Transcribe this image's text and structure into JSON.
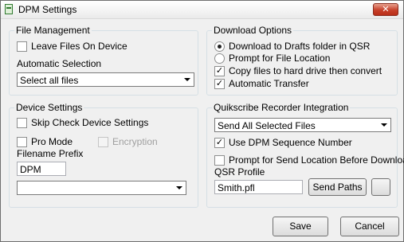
{
  "window": {
    "title": "DPM Settings",
    "close_label": "✕"
  },
  "file_management": {
    "title": "File Management",
    "leave_files_label": "Leave Files On Device",
    "leave_files_checked": false,
    "auto_selection_label": "Automatic Selection",
    "auto_selection_value": "Select all files"
  },
  "device_settings": {
    "title": "Device Settings",
    "skip_check_label": "Skip Check Device Settings",
    "skip_check_checked": false,
    "pro_mode_label": "Pro Mode",
    "pro_mode_checked": false,
    "encryption_label": "Encryption",
    "encryption_checked": false,
    "filename_prefix_label": "Filename Prefix",
    "filename_prefix_value": "DPM",
    "bottom_combo_value": ""
  },
  "download_options": {
    "title": "Download Options",
    "radio_drafts_label": "Download to Drafts folder in QSR",
    "radio_drafts_selected": true,
    "radio_prompt_label": "Prompt for File Location",
    "radio_prompt_selected": false,
    "copy_files_label": "Copy files to hard drive then convert",
    "copy_files_checked": true,
    "auto_transfer_label": "Automatic Transfer",
    "auto_transfer_checked": true
  },
  "qsr_integration": {
    "title": "Quikscribe Recorder Integration",
    "send_mode_value": "Send All Selected Files",
    "use_sequence_label": "Use DPM Sequence Number",
    "use_sequence_checked": true,
    "prompt_send_label": "Prompt for Send Location Before Download",
    "prompt_send_checked": false,
    "qsr_profile_label": "QSR Profile",
    "qsr_profile_value": "Smith.pfl",
    "send_paths_label": "Send Paths",
    "extra_button_label": ""
  },
  "footer": {
    "save_label": "Save",
    "cancel_label": "Cancel"
  }
}
